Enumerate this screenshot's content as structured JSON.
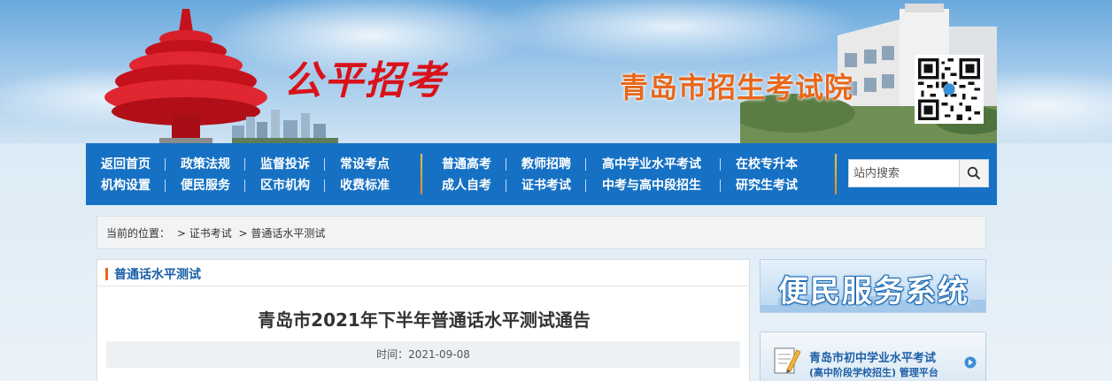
{
  "header": {
    "slogan": "公平招考",
    "institute_name": "青岛市招生考试院",
    "qr_icon": "qr-code-icon"
  },
  "nav": {
    "group1": [
      [
        "返回首页",
        "机构设置"
      ],
      [
        "政策法规",
        "便民服务"
      ],
      [
        "监督投诉",
        "区市机构"
      ],
      [
        "常设考点",
        "收费标准"
      ]
    ],
    "group2": [
      [
        "普通高考",
        "成人自考"
      ],
      [
        "教师招聘",
        "证书考试"
      ],
      [
        "高中学业水平考试",
        "中考与高中段招生"
      ],
      [
        "在校专升本",
        "研究生考试"
      ]
    ],
    "search_placeholder": "站内搜索",
    "search_icon": "search-icon"
  },
  "breadcrumb": {
    "prefix": "当前的位置：",
    "path1": "> 证书考试",
    "path2": "> 普通话水平测试"
  },
  "main": {
    "section_title": "普通话水平测试",
    "article_title": "青岛市2021年下半年普通话水平测试通告",
    "meta": "时间：2021-09-08"
  },
  "sidebar": {
    "service_banner": "便民服务系统",
    "platform_line1": "青岛市初中学业水平考试",
    "platform_line2": "(高中阶段学校招生) 管理平台"
  },
  "colors": {
    "nav_bg": "#1671c4",
    "accent_orange": "#e8671a",
    "slogan_red": "#d9121a"
  }
}
